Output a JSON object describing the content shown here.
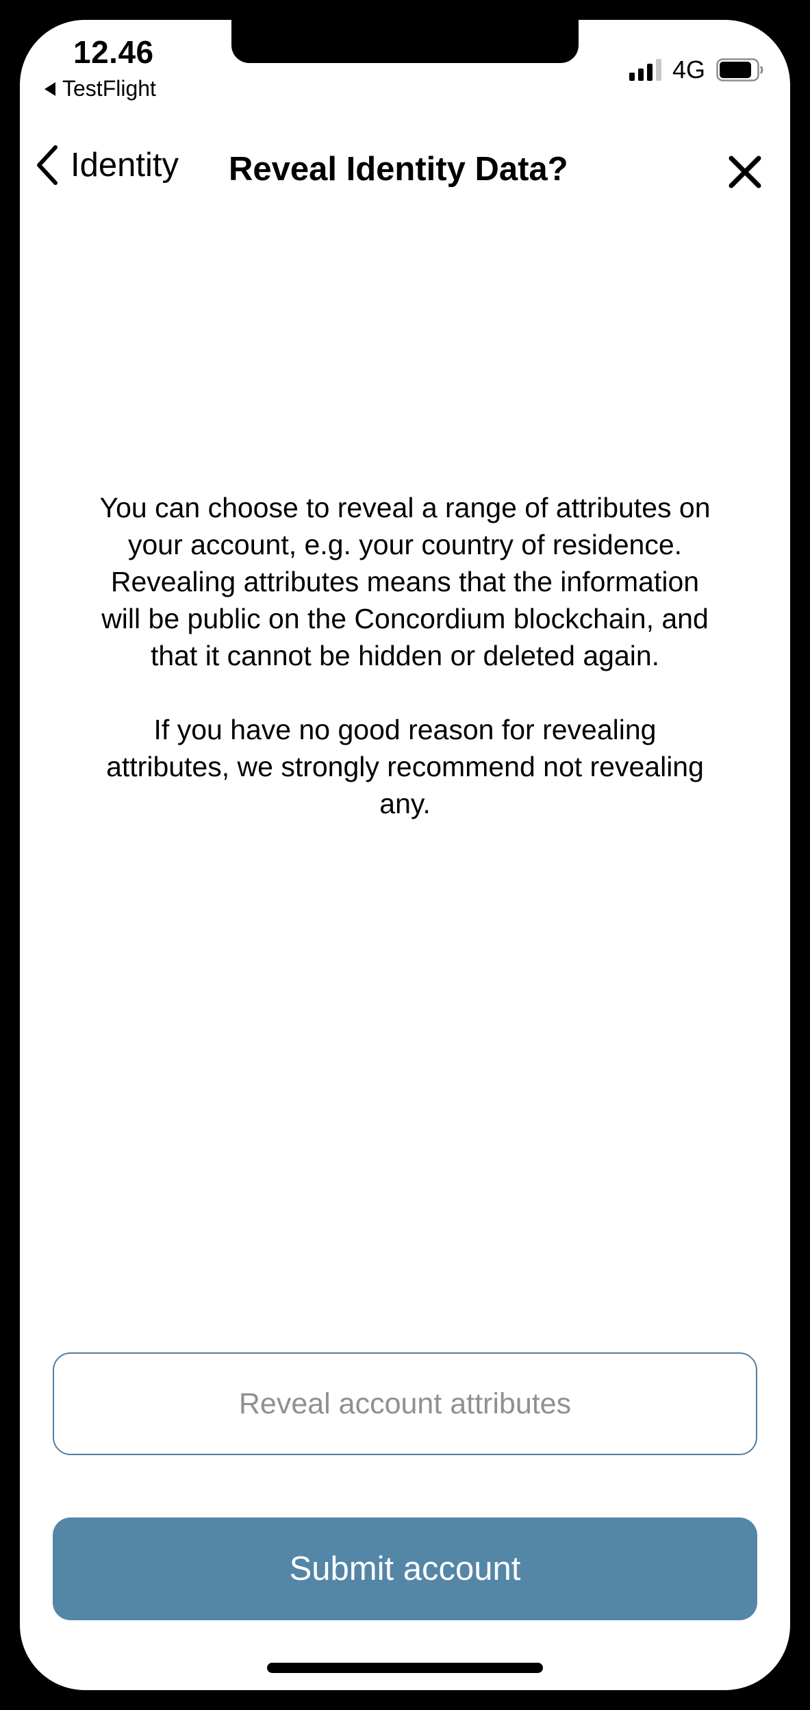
{
  "status_bar": {
    "time": "12.46",
    "back_app": "TestFlight",
    "network": "4G",
    "signal_icon": "cellular-signal-icon",
    "battery_icon": "battery-icon"
  },
  "nav": {
    "back_label": "Identity",
    "back_icon": "chevron-left-icon",
    "title": "Reveal Identity Data?",
    "close_icon": "close-icon"
  },
  "info": {
    "paragraph_1": "You can choose to reveal a range of attributes on your account, e.g. your country of residence. Revealing attributes means that the information will be public on the Concordium blockchain, and that it cannot be hidden or deleted again.",
    "paragraph_2": "If you have no good reason for revealing attributes, we strongly recommend not revealing any."
  },
  "actions": {
    "reveal_label": "Reveal account attributes",
    "submit_label": "Submit account"
  },
  "colors": {
    "primary": "#5486a8",
    "outline": "#4f7ea3",
    "secondary_text": "#909090"
  }
}
